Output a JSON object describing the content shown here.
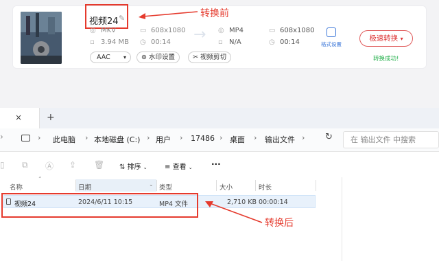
{
  "converter": {
    "file_name": "视频24",
    "source_format": "MKV",
    "source_resolution": "608x1080",
    "source_size": "3.94 MB",
    "source_duration": "00:14",
    "target_format": "MP4",
    "target_resolution": "608x1080",
    "target_size": "N/A",
    "target_duration": "00:14",
    "format_settings_label": "格式设置",
    "codec_select": "AAC",
    "watermark_label": "水印设置",
    "clip_label": "视频剪切",
    "convert_button": "极速转换",
    "status": "转换成功!"
  },
  "annotations": {
    "before": "转换前",
    "after": "转换后"
  },
  "explorer": {
    "tab_add": "+",
    "breadcrumbs": [
      "此电脑",
      "本地磁盘 (C:)",
      "用户",
      "17486",
      "桌面",
      "输出文件"
    ],
    "search_placeholder": "在 输出文件 中搜索",
    "sort_label": "排序",
    "view_label": "查看",
    "more_label": "···",
    "columns": {
      "name": "名称",
      "date": "日期",
      "type": "类型",
      "size": "大小",
      "duration": "时长"
    },
    "file": {
      "name": "视频24",
      "date": "2024/6/11 10:15",
      "type": "MP4 文件",
      "size": "2,710 KB",
      "duration": "00:00:14"
    }
  },
  "colors": {
    "accent_red": "#e53a2d",
    "success_green": "#27b14e"
  }
}
